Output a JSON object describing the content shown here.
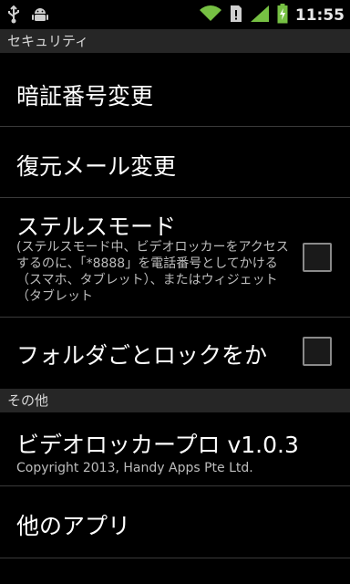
{
  "status_bar": {
    "time": "11:55",
    "icons": [
      "usb-icon",
      "android-icon",
      "wifi-icon",
      "sim-icon",
      "signal-icon",
      "battery-icon"
    ],
    "accent": "#76c043"
  },
  "sections": [
    {
      "header": "セキュリティ"
    },
    {
      "header": "その他"
    }
  ],
  "settings": {
    "change_pin": {
      "title": "暗証番号変更"
    },
    "change_mail": {
      "title": "復元メール変更"
    },
    "stealth_mode": {
      "title": "ステルスモード",
      "summary": "(ステルスモード中、ビデオロッカーをアクセスするのに、「*8888」を電話番号としてかける（スマホ、タブレット）、またはウィジェット（タブレット",
      "checked": false
    },
    "lock_folder": {
      "title": "フォルダごとロックをか",
      "checked": false
    },
    "app_info": {
      "title": "ビデオロッカープロ v1.0.3",
      "copyright": "Copyright 2013, Handy Apps Pte Ltd."
    },
    "other_apps": {
      "title": "他のアプリ"
    }
  }
}
